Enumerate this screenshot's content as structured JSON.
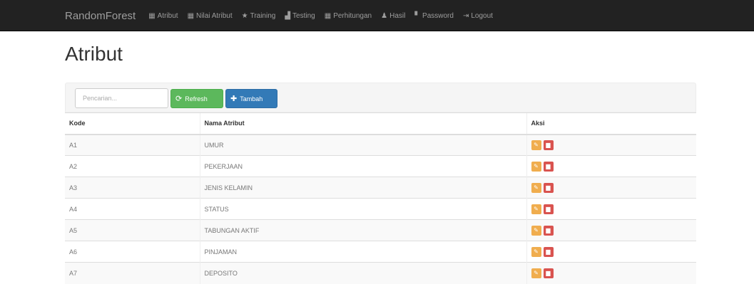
{
  "navbar": {
    "brand": "RandomForest",
    "items": [
      {
        "icon": "table-icon",
        "glyph": "▦",
        "label": "Atribut"
      },
      {
        "icon": "table-icon",
        "glyph": "▦",
        "label": "Nilai Atribut"
      },
      {
        "icon": "star-icon",
        "glyph": "★",
        "label": "Training"
      },
      {
        "icon": "bar-chart-icon",
        "glyph": "▟",
        "label": "Testing"
      },
      {
        "icon": "table-icon",
        "glyph": "▦",
        "label": "Perhitungan"
      },
      {
        "icon": "users-icon",
        "glyph": "♟",
        "label": "Hasil"
      },
      {
        "icon": "lock-icon",
        "glyph": "▘",
        "label": "Password"
      },
      {
        "icon": "logout-icon",
        "glyph": "⇥",
        "label": "Logout"
      }
    ]
  },
  "page": {
    "title": "Atribut"
  },
  "toolbar": {
    "search_placeholder": "Pencarian...",
    "refresh_label": "Refresh",
    "add_label": "Tambah"
  },
  "table": {
    "headers": [
      "Kode",
      "Nama Atribut",
      "Aksi"
    ],
    "rows": [
      {
        "kode": "A1",
        "nama": "UMUR"
      },
      {
        "kode": "A2",
        "nama": "PEKERJAAN"
      },
      {
        "kode": "A3",
        "nama": "JENIS KELAMIN"
      },
      {
        "kode": "A4",
        "nama": "STATUS"
      },
      {
        "kode": "A5",
        "nama": "TABUNGAN AKTIF"
      },
      {
        "kode": "A6",
        "nama": "PINJAMAN"
      },
      {
        "kode": "A7",
        "nama": "DEPOSITO"
      }
    ]
  },
  "colors": {
    "navbar_bg": "#222222",
    "refresh_green": "#5cb85c",
    "add_blue": "#337ab7",
    "edit_orange": "#f0ad4e",
    "delete_red": "#d9534f"
  }
}
